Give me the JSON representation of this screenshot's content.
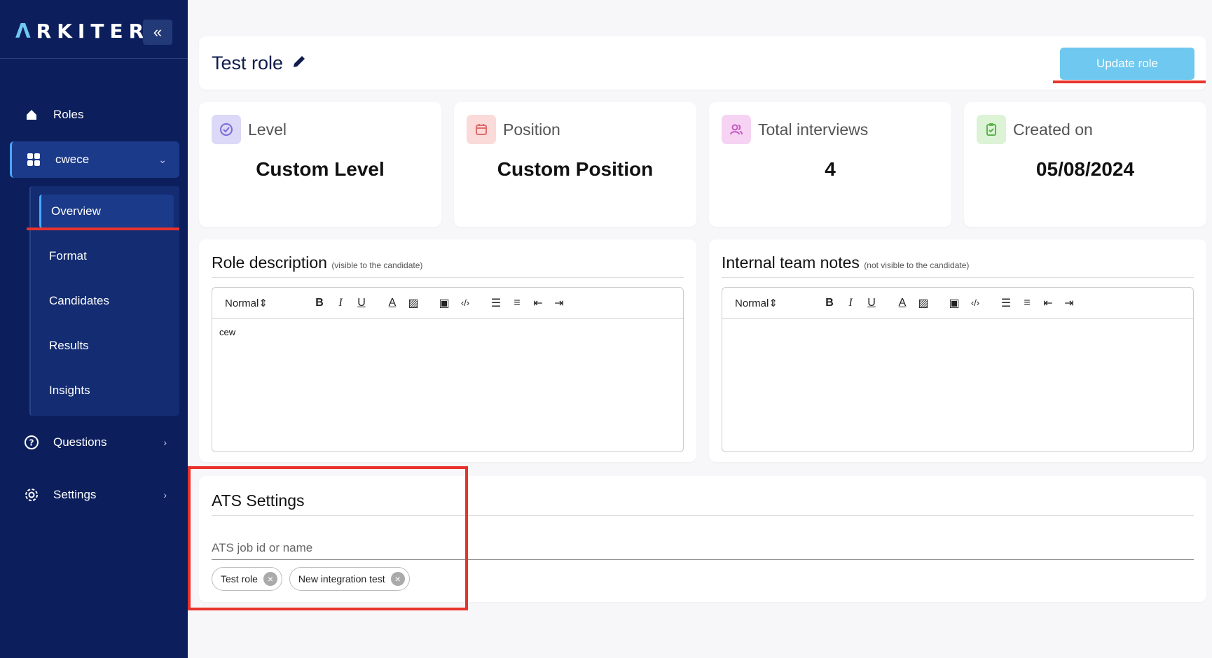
{
  "brand": {
    "logo": "RKITER",
    "logo_mark": "Λ"
  },
  "sidebar": {
    "items": [
      {
        "label": "Roles"
      },
      {
        "label": "cwece"
      },
      {
        "label": "Questions"
      },
      {
        "label": "Settings"
      }
    ],
    "sub_items": [
      {
        "label": "Overview"
      },
      {
        "label": "Format"
      },
      {
        "label": "Candidates"
      },
      {
        "label": "Results"
      },
      {
        "label": "Insights"
      }
    ]
  },
  "header": {
    "title": "Test role",
    "update_label": "Update role"
  },
  "stats": [
    {
      "label": "Level",
      "value": "Custom Level"
    },
    {
      "label": "Position",
      "value": "Custom Position"
    },
    {
      "label": "Total interviews",
      "value": "4"
    },
    {
      "label": "Created on",
      "value": "05/08/2024"
    }
  ],
  "role_description": {
    "title": "Role description",
    "note": "(visible to the candidate)",
    "format": "Normal",
    "content": "cew"
  },
  "team_notes": {
    "title": "Internal team notes",
    "note": "(not visible to the candidate)",
    "format": "Normal",
    "content": ""
  },
  "ats": {
    "title": "ATS Settings",
    "placeholder": "ATS job id or name",
    "chips": [
      {
        "label": "Test role"
      },
      {
        "label": "New integration test"
      }
    ]
  },
  "colors": {
    "sidebar": "#0c1f5c",
    "accent": "#6ec8ef",
    "highlight": "#e8332c"
  }
}
